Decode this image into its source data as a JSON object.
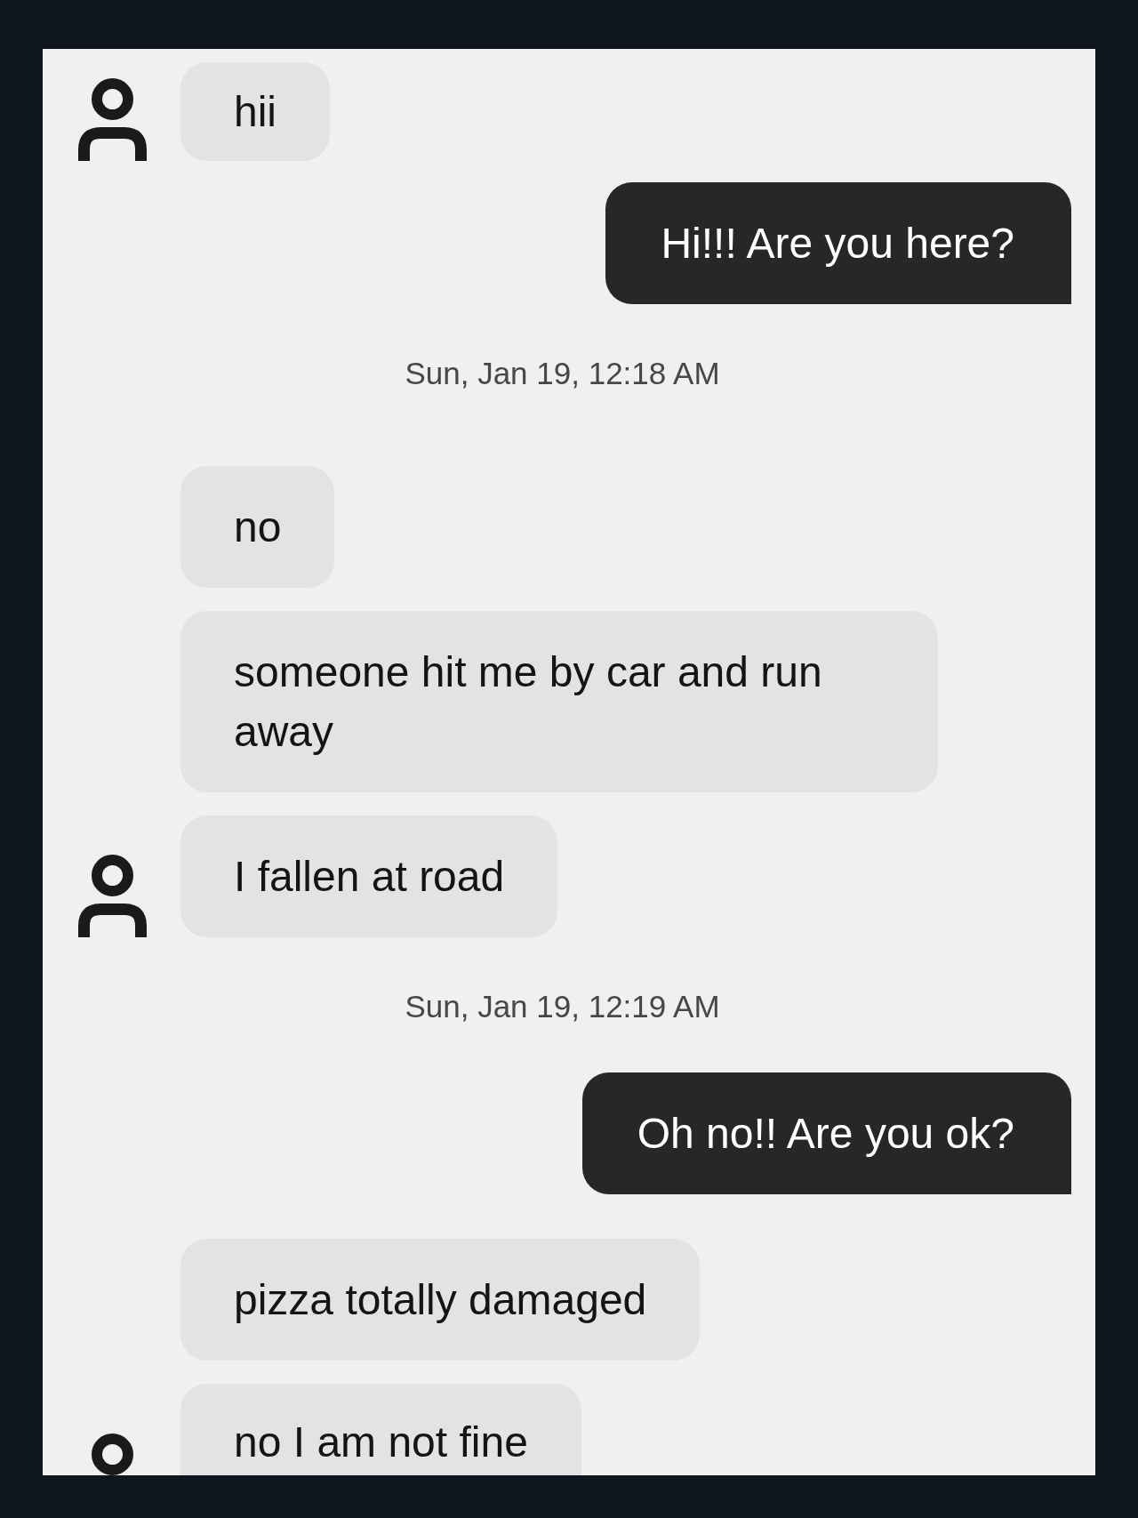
{
  "messages": [
    {
      "kind": "incoming",
      "text": "hii",
      "avatar": true
    },
    {
      "kind": "outgoing",
      "text": "Hi!!! Are you here?"
    },
    {
      "kind": "timestamp",
      "text": "Sun, Jan 19, 12:18 AM"
    },
    {
      "kind": "incoming",
      "text": "no",
      "avatar": false
    },
    {
      "kind": "incoming",
      "text": "someone hit me by car and run away",
      "avatar": false
    },
    {
      "kind": "incoming",
      "text": "I fallen at road",
      "avatar": true
    },
    {
      "kind": "timestamp",
      "text": "Sun, Jan 19, 12:19 AM"
    },
    {
      "kind": "outgoing",
      "text": "Oh no!! Are you ok?"
    },
    {
      "kind": "incoming",
      "text": "pizza totally damaged",
      "avatar": false
    },
    {
      "kind": "incoming",
      "text": "no I am not fine",
      "avatar": true
    }
  ]
}
